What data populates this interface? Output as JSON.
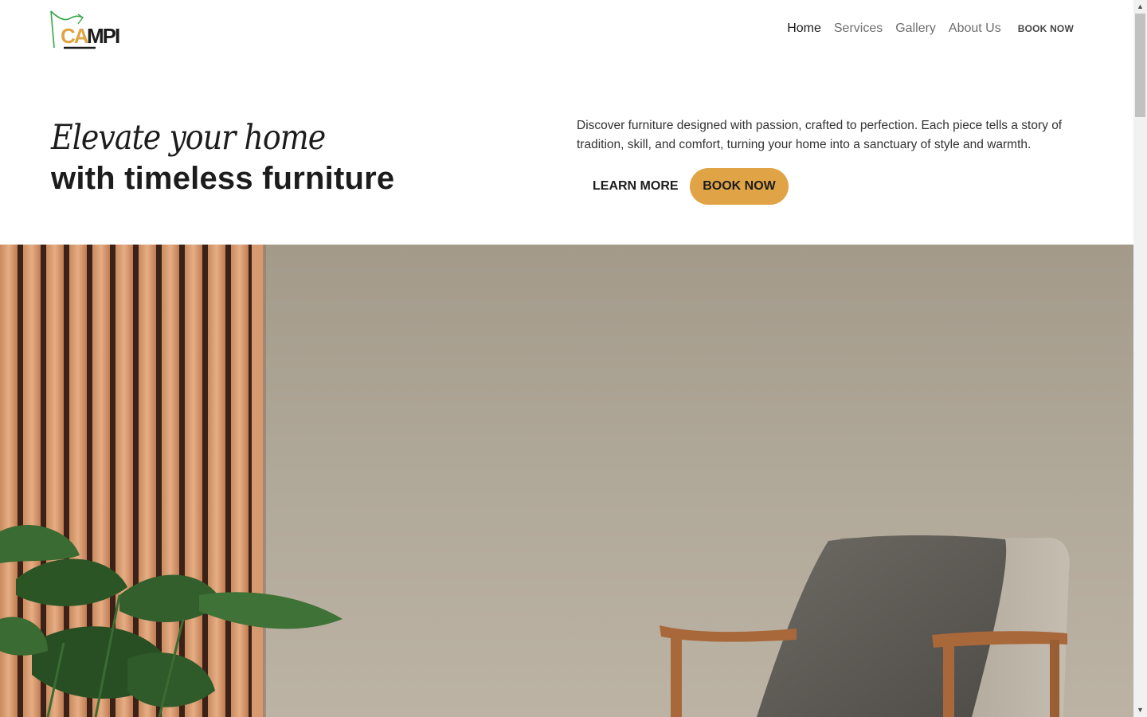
{
  "brand": {
    "logo_text_accent": "CA",
    "logo_text_rest": "MPI",
    "accent_color": "#e0a446"
  },
  "nav": {
    "items": [
      {
        "label": "Home",
        "active": true
      },
      {
        "label": "Services"
      },
      {
        "label": "Gallery"
      },
      {
        "label": "About Us"
      }
    ],
    "book_label": "BOOK NOW"
  },
  "hero": {
    "script_title": "Elevate your home",
    "title": "with timeless furniture",
    "description": "Discover furniture designed with passion, crafted to perfection. Each piece tells a story of tradition, skill, and comfort, turning your home into a sanctuary of style and warmth.",
    "learn_more_label": "LEARN MORE",
    "book_now_label": "BOOK NOW"
  },
  "image": {
    "subject": "wooden slat wall, monstera plant, wooden armchair with grey pillow"
  },
  "scrollbar": {
    "up_icon": "▲",
    "down_icon": "▼"
  }
}
